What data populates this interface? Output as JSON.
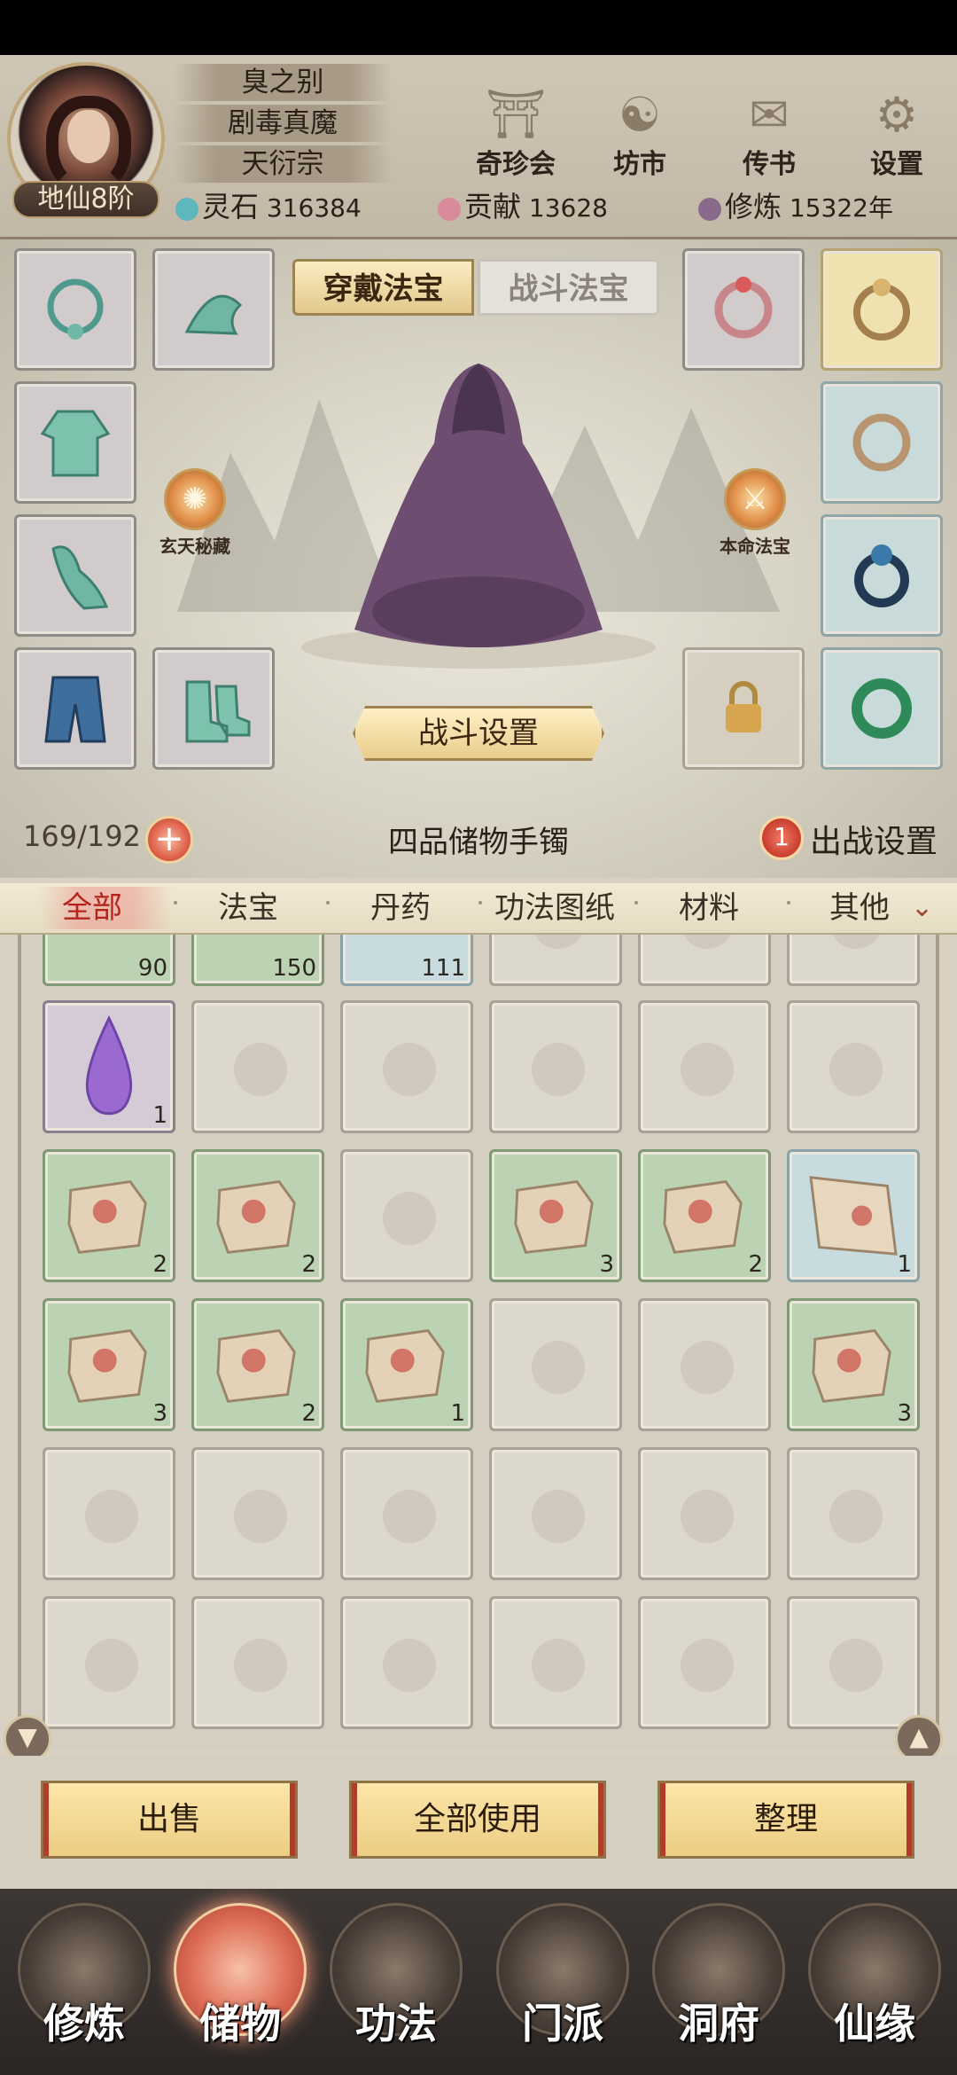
{
  "header": {
    "player_name": "臭之别",
    "title": "剧毒真魔",
    "sect": "天衍宗",
    "realm": "地仙8阶",
    "nav": [
      {
        "label": "奇珍会",
        "icon": "treasure-pavilion-icon"
      },
      {
        "label": "坊市",
        "icon": "market-icon"
      },
      {
        "label": "传书",
        "icon": "letter-icon"
      },
      {
        "label": "设置",
        "icon": "gear-icon"
      }
    ],
    "resources": {
      "spirit_stone_label": "灵石",
      "spirit_stone_value": "316384",
      "contribution_label": "贡献",
      "contribution_value": "13628",
      "cultivation_label": "修炼",
      "cultivation_value": "15322年"
    }
  },
  "equip": {
    "tabs": {
      "wear": "穿戴法宝",
      "battle": "战斗法宝"
    },
    "skill_left": "玄天秘藏",
    "skill_right": "本命法宝",
    "battle_settings": "战斗设置"
  },
  "bag": {
    "capacity": "169/192",
    "name": "四品储物手镯",
    "deploy_count": "1",
    "deploy_label": "出战设置"
  },
  "categories": [
    "全部",
    "法宝",
    "丹药",
    "功法图纸",
    "材料",
    "其他"
  ],
  "grid": {
    "row0": [
      "90",
      "150",
      "111",
      "",
      "",
      ""
    ],
    "row1": [
      "1",
      "",
      "",
      "",
      "",
      ""
    ],
    "row2": [
      "2",
      "2",
      "",
      "3",
      "2",
      "1"
    ],
    "row3": [
      "3",
      "2",
      "1",
      "",
      "",
      "3"
    ]
  },
  "actions": {
    "sell": "出售",
    "use_all": "全部使用",
    "sort": "整理"
  },
  "bottom_nav": [
    "修炼",
    "储物",
    "功法",
    "门派",
    "洞府",
    "仙缘"
  ],
  "colors": {
    "accent_red": "#b4241d",
    "gold": "#eccd83",
    "green_cell": "#bcd3b3",
    "blue_cell": "#c8dbdf"
  }
}
